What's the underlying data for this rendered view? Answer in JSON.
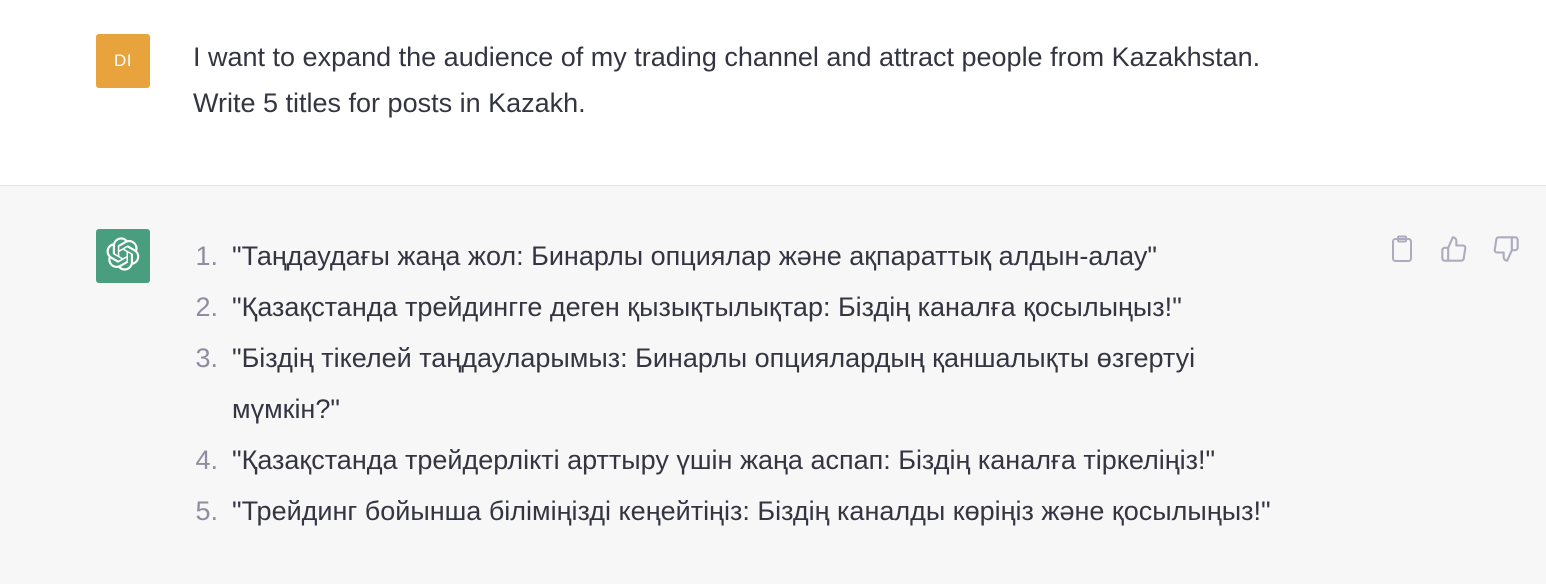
{
  "user": {
    "avatar_initials": "DI",
    "message_lines": [
      "I want to expand the audience of my trading channel and attract people from Kazakhstan.",
      "Write 5 titles for posts in Kazakh."
    ]
  },
  "assistant": {
    "avatar_icon": "openai-logo-icon",
    "items": [
      {
        "num": "1.",
        "text": "\"Таңдаудағы жаңа жол: Бинарлы опциялар және ақпараттық алдын-алау\""
      },
      {
        "num": "2.",
        "text": "\"Қазақстанда трейдингге деген қызықтылықтар: Біздің каналға қосылыңыз!\""
      },
      {
        "num": "3.",
        "text": "\"Біздің тікелей таңдауларымыз: Бинарлы опциялардың қаншалықты өзгертуі мүмкін?\""
      },
      {
        "num": "4.",
        "text": "\"Қазақстанда трейдерлікті арттыру үшін жаңа аспап: Біздің каналға тіркеліңіз!\""
      },
      {
        "num": "5.",
        "text": "\"Трейдинг бойынша біліміңізді кеңейтіңіз: Біздің каналды көріңіз және қосылыңыз!\""
      }
    ],
    "actions": [
      "clipboard-icon",
      "thumbs-up-icon",
      "thumbs-down-icon"
    ]
  },
  "colors": {
    "user_avatar": "#e8a33d",
    "assistant_avatar": "#4a9e80",
    "assistant_background": "#f7f7f8",
    "text": "#343541"
  }
}
